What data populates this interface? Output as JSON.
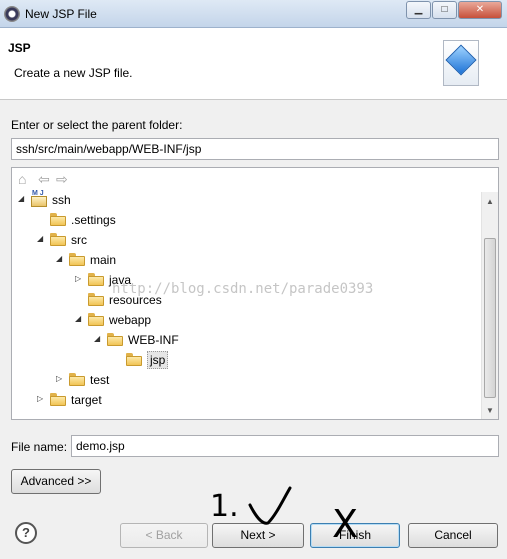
{
  "window": {
    "title": "New JSP File"
  },
  "header": {
    "title": "JSP",
    "description": "Create a new JSP file."
  },
  "folder": {
    "label": "Enter or select the parent folder:",
    "value": "ssh/src/main/webapp/WEB-INF/jsp"
  },
  "tree": {
    "nodes": [
      {
        "label": "ssh",
        "depth": 0,
        "expanded": true,
        "icon": "project-icon"
      },
      {
        "label": ".settings",
        "depth": 1,
        "expanded": null,
        "icon": "folder-icon"
      },
      {
        "label": "src",
        "depth": 1,
        "expanded": true,
        "icon": "folder-icon"
      },
      {
        "label": "main",
        "depth": 2,
        "expanded": true,
        "icon": "folder-icon"
      },
      {
        "label": "java",
        "depth": 3,
        "expanded": false,
        "icon": "folder-icon"
      },
      {
        "label": "resources",
        "depth": 3,
        "expanded": null,
        "icon": "folder-icon"
      },
      {
        "label": "webapp",
        "depth": 3,
        "expanded": true,
        "icon": "folder-icon"
      },
      {
        "label": "WEB-INF",
        "depth": 4,
        "expanded": true,
        "icon": "folder-icon"
      },
      {
        "label": "jsp",
        "depth": 5,
        "expanded": null,
        "icon": "folder-icon",
        "selected": true
      },
      {
        "label": "test",
        "depth": 2,
        "expanded": false,
        "icon": "folder-icon"
      },
      {
        "label": "target",
        "depth": 1,
        "expanded": false,
        "icon": "folder-icon"
      }
    ],
    "watermark": "http://blog.csdn.net/parade0393"
  },
  "file": {
    "label": "File name:",
    "value": "demo.jsp"
  },
  "buttons": {
    "advanced": "Advanced >>",
    "back": "< Back",
    "next": "Next >",
    "finish": "Finish",
    "cancel": "Cancel"
  },
  "annotations": {
    "next_mark": "1.",
    "finish_mark": "X"
  }
}
